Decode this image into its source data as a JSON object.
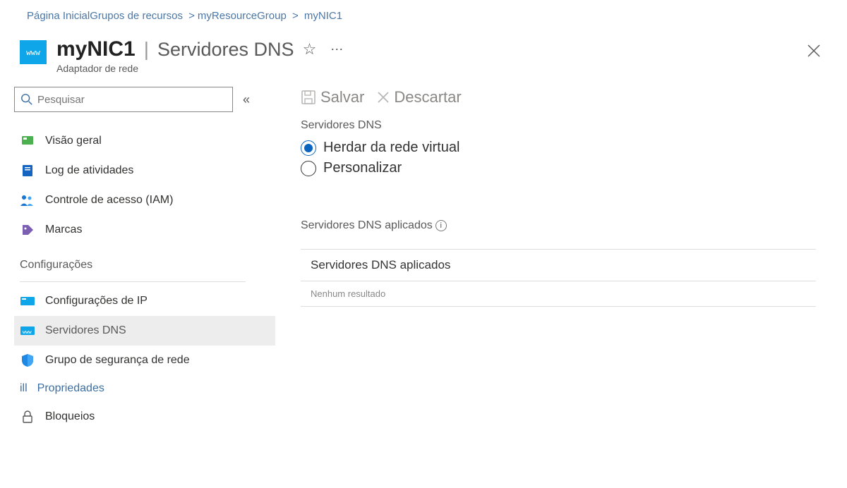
{
  "breadcrumb": {
    "home": "Página Inicial",
    "resource_groups": "Grupos de recursos",
    "rg_name": "myResourceGroup",
    "resource": "myNIC1"
  },
  "header": {
    "title": "myNIC1",
    "section": "Servidores DNS",
    "subtitle": "Adaptador de rede"
  },
  "search": {
    "placeholder": "Pesquisar"
  },
  "nav": {
    "overview": "Visão geral",
    "activity_log": "Log de atividades",
    "iam": "Controle de acesso (IAM)",
    "tags": "Marcas",
    "settings_group": "Configurações",
    "ip_config": "Configurações de IP",
    "dns_servers": "Servidores DNS",
    "nsg": "Grupo de segurança de rede",
    "properties_prefix": "ill",
    "properties": "Propriedades",
    "locks": "Bloqueios"
  },
  "toolbar": {
    "save": "Salvar",
    "discard": "Descartar"
  },
  "form": {
    "dns_servers_label": "Servidores DNS",
    "option_inherit": "Herdar da rede virtual",
    "option_custom": "Personalizar"
  },
  "applied": {
    "title": "Servidores DNS aplicados",
    "column": "Servidores DNS aplicados",
    "empty": "Nenhum resultado"
  }
}
